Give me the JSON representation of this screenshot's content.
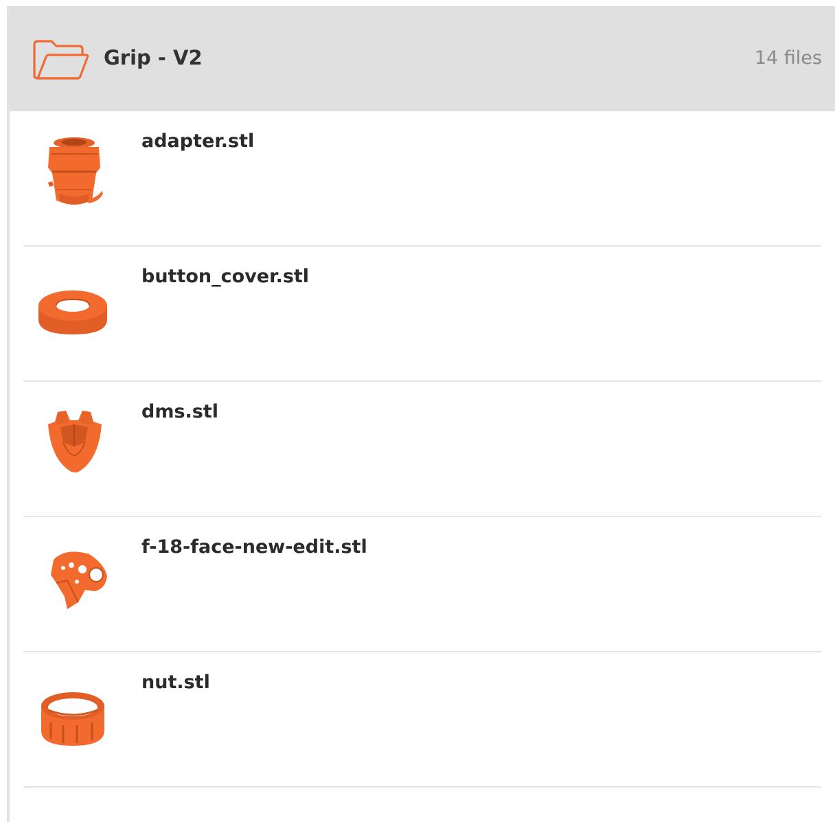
{
  "folder": {
    "title": "Grip - V2",
    "file_count": "14 files",
    "icon": "folder-open-icon",
    "accent_color": "#f06a35"
  },
  "files": [
    {
      "name": "adapter.stl",
      "thumbnail": "adapter-model-thumbnail"
    },
    {
      "name": "button_cover.stl",
      "thumbnail": "ring-model-thumbnail"
    },
    {
      "name": "dms.stl",
      "thumbnail": "dms-model-thumbnail"
    },
    {
      "name": "f-18-face-new-edit.stl",
      "thumbnail": "face-model-thumbnail"
    },
    {
      "name": "nut.stl",
      "thumbnail": "nut-model-thumbnail"
    }
  ],
  "colors": {
    "model_orange": "#f26a2e",
    "model_dark": "#c4501c",
    "header_bg": "#e0e0e0"
  }
}
